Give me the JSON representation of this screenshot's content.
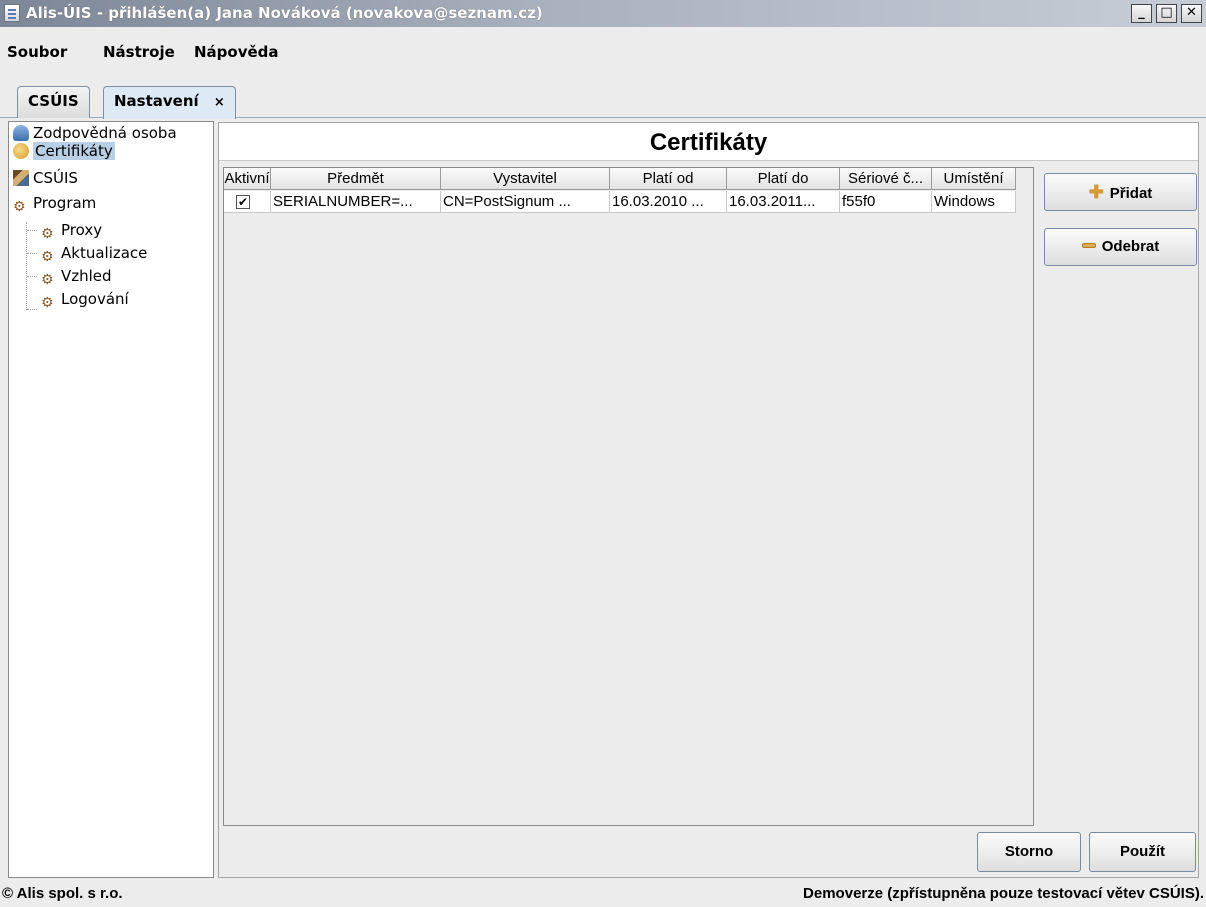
{
  "window": {
    "title": "Alis-ÚIS - přihlášen(a) Jana Nováková (novakova@seznam.cz)",
    "min": "_",
    "max": "□",
    "close": "✕"
  },
  "menu": [
    "Soubor",
    "Nástroje",
    "Nápověda"
  ],
  "tabs": [
    {
      "label": "CSÚIS",
      "active": false
    },
    {
      "label": "Nastavení",
      "active": true,
      "close": "×"
    }
  ],
  "tree": [
    {
      "label": "Zodpovědná osoba",
      "icon": "person-icon"
    },
    {
      "label": "Certifikáty",
      "icon": "certificate-icon",
      "selected": true
    },
    {
      "label": "CSÚIS",
      "icon": "csuis-icon"
    },
    {
      "label": "Program",
      "icon": "gear-icon"
    },
    {
      "label": "Proxy",
      "icon": "gear-icon"
    },
    {
      "label": "Aktualizace",
      "icon": "gear-icon"
    },
    {
      "label": "Vzhled",
      "icon": "gear-icon"
    },
    {
      "label": "Logování",
      "icon": "gear-icon"
    }
  ],
  "panel": {
    "title": "Certifikáty",
    "columns": [
      "Aktivní",
      "Předmět",
      "Vystavitel",
      "Platí od",
      "Platí do",
      "Sériové č...",
      "Umístění"
    ],
    "rows": [
      {
        "active": true,
        "check_mark": "✔",
        "subject": "SERIALNUMBER=...",
        "issuer": "CN=PostSignum ...",
        "valid_from": "16.03.2010 ...",
        "valid_to": "16.03.2011...",
        "serial": "f55f0",
        "location": "Windows"
      }
    ],
    "add_button": "Přidat",
    "remove_button": "Odebrat",
    "cancel_button": "Storno",
    "apply_button": "Použít"
  },
  "status": {
    "left": "© Alis spol. s r.o.",
    "right": "Demoverze (zpřístupněna pouze testovací větev CSÚIS)."
  }
}
